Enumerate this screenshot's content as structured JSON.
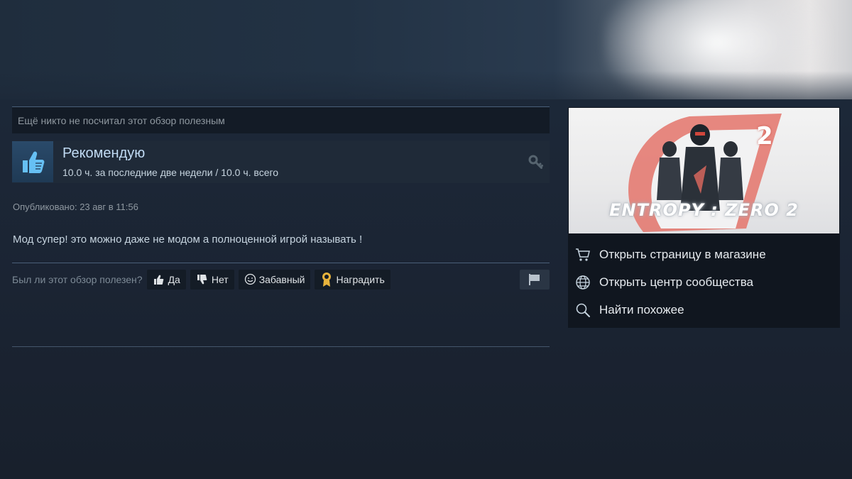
{
  "review": {
    "helpful_count_text": "Ещё никто не посчитал этот обзор полезным",
    "recommendation": "Рекомендую",
    "hours": "10.0 ч. за последние две недели / 10.0 ч. всего",
    "posted": "Опубликовано: 23 авг в 11:56",
    "text": "Мод супер! это можно даже не модом а полноценной игрой называть !",
    "vote_question": "Был ли этот обзор полезен?",
    "buttons": {
      "yes": "Да",
      "no": "Нет",
      "funny": "Забавный",
      "award": "Наградить"
    }
  },
  "game": {
    "logo_text": "ENTROPY : ZERO 2",
    "logo_number": "2",
    "links": [
      {
        "label": "Открыть страницу в магазине",
        "icon": "cart-icon"
      },
      {
        "label": "Открыть центр сообщества",
        "icon": "globe-icon"
      },
      {
        "label": "Найти похожее",
        "icon": "search-icon"
      }
    ]
  },
  "colors": {
    "accent_blue": "#c1dbf4",
    "award_gold": "#e8b33c",
    "logo_red": "#d9534a"
  }
}
